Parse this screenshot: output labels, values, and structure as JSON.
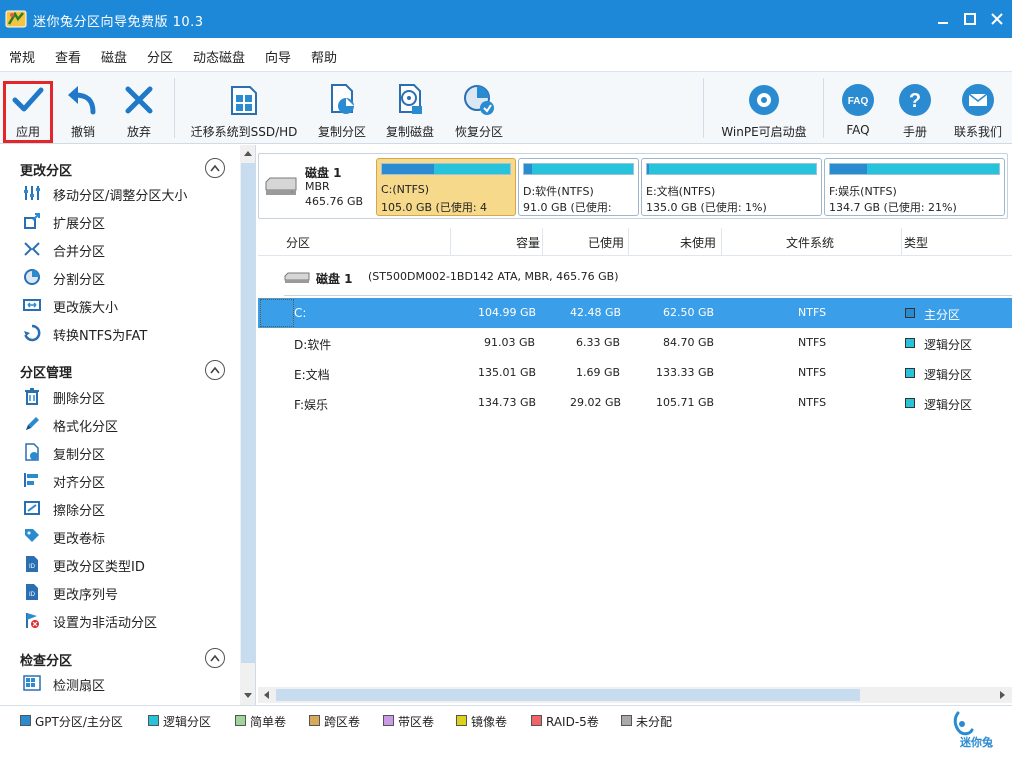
{
  "window": {
    "title": "迷你兔分区向导免费版 10.3"
  },
  "menu": [
    "常规",
    "查看",
    "磁盘",
    "分区",
    "动态磁盘",
    "向导",
    "帮助"
  ],
  "toolbar": {
    "apply": "应用",
    "undo": "撤销",
    "discard": "放弃",
    "migrate": "迁移系统到SSD/HD",
    "copy_partition": "复制分区",
    "copy_disk": "复制磁盘",
    "recover_partition": "恢复分区",
    "winpe": "WinPE可启动盘",
    "faq": "FAQ",
    "manual": "手册",
    "contact": "联系我们"
  },
  "sidebar": {
    "sections": [
      {
        "title": "更改分区",
        "items": [
          "移动分区/调整分区大小",
          "扩展分区",
          "合并分区",
          "分割分区",
          "更改簇大小",
          "转换NTFS为FAT"
        ]
      },
      {
        "title": "分区管理",
        "items": [
          "删除分区",
          "格式化分区",
          "复制分区",
          "对齐分区",
          "擦除分区",
          "更改卷标",
          "更改分区类型ID",
          "更改序列号",
          "设置为非活动分区"
        ]
      },
      {
        "title": "检查分区",
        "items": [
          "检测扇区"
        ]
      }
    ]
  },
  "diskmap": {
    "disk_name": "磁盘 1",
    "disk_type": "MBR",
    "disk_size": "465.76 GB",
    "partitions": [
      {
        "name": "C:(NTFS)",
        "info": "105.0 GB (已使用: 4",
        "used_fraction": 0.405,
        "selected": true
      },
      {
        "name": "D:软件(NTFS)",
        "info": "91.0 GB (已使用:",
        "used_fraction": 0.07,
        "selected": false
      },
      {
        "name": "E:文档(NTFS)",
        "info": "135.0 GB (已使用: 1%)",
        "used_fraction": 0.013,
        "selected": false
      },
      {
        "name": "F:娱乐(NTFS)",
        "info": "134.7 GB (已使用: 21%)",
        "used_fraction": 0.216,
        "selected": false
      }
    ]
  },
  "table": {
    "headers": {
      "partition": "分区",
      "capacity": "容量",
      "used": "已使用",
      "unused": "未使用",
      "filesystem": "文件系统",
      "type": "类型"
    },
    "disk_title": "磁盘 1",
    "disk_subtitle": "(ST500DM002-1BD142 ATA, MBR, 465.76 GB)",
    "rows": [
      {
        "name": "C:",
        "capacity": "104.99 GB",
        "used": "42.48 GB",
        "unused": "62.50 GB",
        "fs": "NTFS",
        "type": "主分区",
        "type_color": "#2b8bd1"
      },
      {
        "name": "D:软件",
        "capacity": "91.03 GB",
        "used": "6.33 GB",
        "unused": "84.70 GB",
        "fs": "NTFS",
        "type": "逻辑分区",
        "type_color": "#27c3db"
      },
      {
        "name": "E:文档",
        "capacity": "135.01 GB",
        "used": "1.69 GB",
        "unused": "133.33 GB",
        "fs": "NTFS",
        "type": "逻辑分区",
        "type_color": "#27c3db"
      },
      {
        "name": "F:娱乐",
        "capacity": "134.73 GB",
        "used": "29.02 GB",
        "unused": "105.71 GB",
        "fs": "NTFS",
        "type": "逻辑分区",
        "type_color": "#27c3db"
      }
    ]
  },
  "legend": [
    {
      "label": "GPT分区/主分区",
      "color": "#2b8bd1"
    },
    {
      "label": "逻辑分区",
      "color": "#27c3db"
    },
    {
      "label": "简单卷",
      "color": "#9fd49a"
    },
    {
      "label": "跨区卷",
      "color": "#d7a95a"
    },
    {
      "label": "带区卷",
      "color": "#c99be6"
    },
    {
      "label": "镜像卷",
      "color": "#dcd21e"
    },
    {
      "label": "RAID-5卷",
      "color": "#f0636b"
    },
    {
      "label": "未分配",
      "color": "#a9a9a9"
    }
  ],
  "brand": {
    "logo_text": "迷你兔"
  },
  "colors": {
    "titlebar": "#1e88d8",
    "accent": "#2b8bd1",
    "selected_row": "#3a9ee8",
    "apply_highlight": "#e4252a"
  }
}
